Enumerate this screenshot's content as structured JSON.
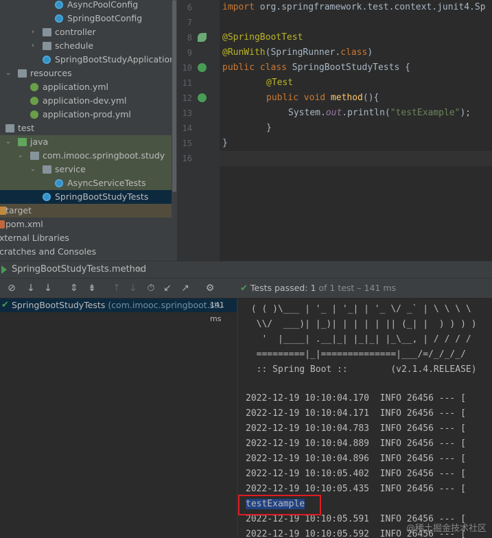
{
  "project_tree": {
    "rows": [
      {
        "label": "AsyncPoolConfig",
        "icon": "class-icon",
        "arrow": ""
      },
      {
        "label": "SpringBootConfig",
        "icon": "class-icon",
        "arrow": ""
      },
      {
        "label": "controller",
        "icon": "folder-icon",
        "arrow": "›"
      },
      {
        "label": "schedule",
        "icon": "folder-icon",
        "arrow": "›"
      },
      {
        "label": "SpringBootStudyApplication",
        "icon": "class-icon",
        "arrow": ""
      },
      {
        "label": "resources",
        "icon": "resources-folder-icon",
        "arrow": "⌄"
      },
      {
        "label": "application.yml",
        "icon": "yaml-icon",
        "arrow": ""
      },
      {
        "label": "application-dev.yml",
        "icon": "yaml-icon",
        "arrow": ""
      },
      {
        "label": "application-prod.yml",
        "icon": "yaml-icon",
        "arrow": ""
      },
      {
        "label": "test",
        "icon": "folder-icon",
        "arrow": ""
      },
      {
        "label": "java",
        "icon": "test-folder-icon",
        "arrow": "⌄"
      },
      {
        "label": "com.imooc.springboot.study",
        "icon": "package-icon",
        "arrow": "⌄"
      },
      {
        "label": "service",
        "icon": "package-icon",
        "arrow": "⌄"
      },
      {
        "label": "AsyncServiceTests",
        "icon": "class-icon",
        "arrow": ""
      },
      {
        "label": "SpringBootStudyTests",
        "icon": "class-icon",
        "arrow": ""
      },
      {
        "label": "target",
        "icon": "excluded-folder-icon",
        "arrow": ""
      },
      {
        "label": "pom.xml",
        "icon": "maven-icon",
        "arrow": ""
      },
      {
        "label": "xternal Libraries",
        "icon": "",
        "arrow": ""
      },
      {
        "label": "cratches and Consoles",
        "icon": "",
        "arrow": ""
      }
    ]
  },
  "editor": {
    "line_numbers": [
      "6",
      "7",
      "8",
      "9",
      "10",
      "11",
      "12",
      "13",
      "14",
      "15",
      "16"
    ],
    "code": {
      "l6_kw": "import",
      "l6_rest": " org.springframework.test.context.junit4.Sp",
      "l8_ann": "@SpringBootTest",
      "l9_ann": "@RunWith",
      "l9_open": "(SpringRunner.",
      "l9_kw": "class",
      "l9_close": ")",
      "l10_kw": "public class",
      "l10_rest": " SpringBootStudyTests {",
      "l11_ann": "@Test",
      "l12_kw": "public void",
      "l12_space": " ",
      "l12_method": "method",
      "l12_rest": "(){",
      "l13_sys": "System.",
      "l13_field": "out",
      "l13_call": ".println(",
      "l13_str": "\"testExample\"",
      "l13_end": ");",
      "l14": "}",
      "l15": "}"
    }
  },
  "run_panel": {
    "tab_label": "SpringBootStudyTests.method",
    "close_glyph": "×",
    "status": {
      "check": "✔",
      "passed": "Tests passed:",
      "count": "1",
      "of": "of 1 test – 141 ms"
    },
    "test_tree": {
      "name": "SpringBootStudyTests",
      "pkg": "(com.imooc.springboot.stu",
      "time": "141 ms",
      "check": "✔"
    },
    "console": {
      "banner": [
        " ( ( )\\___ | '_ | '_| | '_ \\/ _` | \\ \\ \\ \\",
        "  \\\\/  ___)| |_)| | | | | || (_| |  ) ) ) )",
        "   '  |____| .__|_| |_|_| |_\\__, | / / / /",
        "  =========|_|==============|___/=/_/_/_/",
        "  :: Spring Boot ::        (v2.1.4.RELEASE)"
      ],
      "logs": [
        "2022-12-19 10:10:04.170  INFO 26456 --- [",
        "2022-12-19 10:10:04.171  INFO 26456 --- [",
        "2022-12-19 10:10:04.783  INFO 26456 --- [",
        "2022-12-19 10:10:04.889  INFO 26456 --- [",
        "2022-12-19 10:10:04.896  INFO 26456 --- [",
        "2022-12-19 10:10:05.402  INFO 26456 --- [",
        "2022-12-19 10:10:05.435  INFO 26456 --- ["
      ],
      "output": "testExample",
      "logs_after": [
        "2022-12-19 10:10:05.591  INFO 26456 --- [",
        "2022-12-19 10:10:05.592  INFO 26456 --- ["
      ]
    }
  },
  "watermark": "@稀土掘金技术社区",
  "colors": {
    "background": "#2b2b2b",
    "tree_background": "#3c3f41",
    "selection": "#0d293e",
    "pass_green": "#499c54",
    "highlight_box": "#e01b24"
  }
}
